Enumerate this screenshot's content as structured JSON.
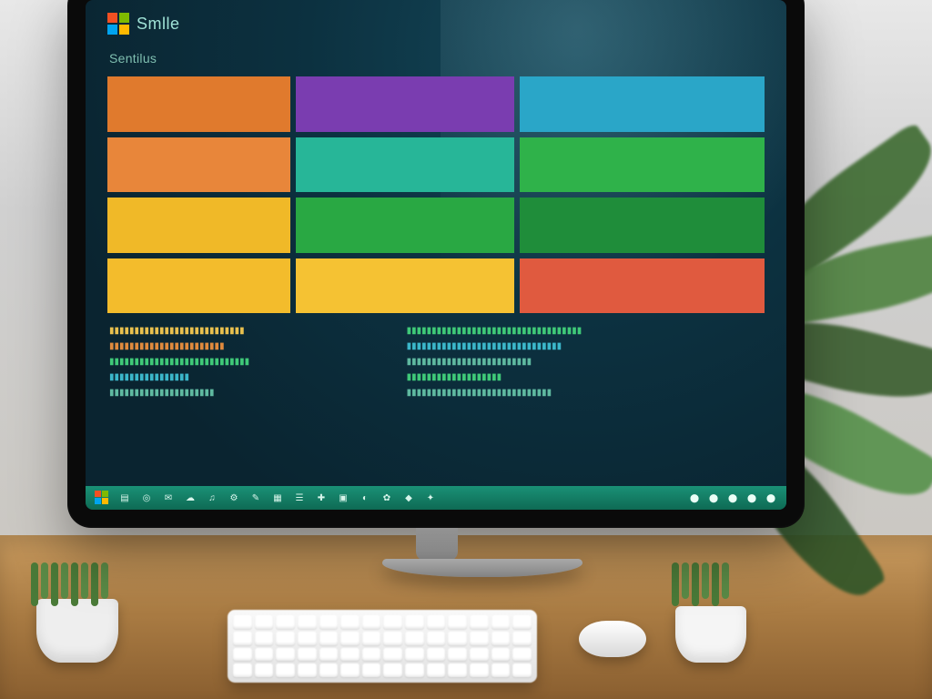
{
  "brand": "Smlle",
  "section_heading": "Sentilus",
  "tiles": [
    {
      "id": "t1",
      "color": "c-orange1",
      "title": "",
      "sub": ""
    },
    {
      "id": "t2",
      "color": "c-purple muted",
      "title": "",
      "sub": ""
    },
    {
      "id": "t3",
      "color": "c-cyan muted",
      "title": "",
      "sub": ""
    },
    {
      "id": "t4",
      "color": "c-orange2",
      "title": "",
      "sub": ""
    },
    {
      "id": "t5",
      "color": "c-teal muted",
      "title": "",
      "sub": ""
    },
    {
      "id": "t6",
      "color": "c-green1 muted",
      "title": "",
      "sub": ""
    },
    {
      "id": "t7",
      "color": "c-yellow1",
      "title": "",
      "sub": ""
    },
    {
      "id": "t8",
      "color": "c-green2 muted",
      "title": "",
      "sub": ""
    },
    {
      "id": "t9",
      "color": "c-green3 muted",
      "title": "",
      "sub": ""
    },
    {
      "id": "t10",
      "color": "c-yellow2",
      "title": "",
      "sub": ""
    },
    {
      "id": "t11",
      "color": "c-yellow3",
      "title": "",
      "sub": ""
    },
    {
      "id": "t12",
      "color": "c-red muted",
      "title": "",
      "sub": ""
    }
  ],
  "code_left": [
    {
      "cls": "hl-y",
      "txt": "▮▮▮▮▮▮▮▮▮▮▮▮▮▮▮▮▮▮▮▮▮▮▮▮▮▮▮"
    },
    {
      "cls": "hl-o",
      "txt": "▮▮▮▮▮▮▮▮▮▮▮▮▮▮▮▮▮▮▮▮▮▮▮"
    },
    {
      "cls": "hl-g",
      "txt": "▮▮▮▮▮▮▮▮▮▮▮▮▮▮▮▮▮▮▮▮▮▮▮▮▮▮▮▮"
    },
    {
      "cls": "hl-c",
      "txt": "▮▮▮▮▮▮▮▮▮▮▮▮▮▮▮▮"
    },
    {
      "cls": "",
      "txt": "▮▮▮▮▮▮▮▮▮▮▮▮▮▮▮▮▮▮▮▮▮"
    }
  ],
  "code_right": [
    {
      "cls": "hl-g",
      "txt": "▮▮▮▮▮▮▮▮▮▮▮▮▮▮▮▮▮▮▮▮▮▮▮▮▮▮▮▮▮▮▮▮▮▮▮"
    },
    {
      "cls": "hl-c",
      "txt": "▮▮▮▮▮▮▮▮▮▮▮▮▮▮▮▮▮▮▮▮▮▮▮▮▮▮▮▮▮▮▮"
    },
    {
      "cls": "",
      "txt": "▮▮▮▮▮▮▮▮▮▮▮▮▮▮▮▮▮▮▮▮▮▮▮▮▮"
    },
    {
      "cls": "hl-g",
      "txt": "▮▮▮▮▮▮▮▮▮▮▮▮▮▮▮▮▮▮▮"
    },
    {
      "cls": "",
      "txt": "▮▮▮▮▮▮▮▮▮▮▮▮▮▮▮▮▮▮▮▮▮▮▮▮▮▮▮▮▮"
    }
  ],
  "taskbar_icons": [
    "▤",
    "◎",
    "✉",
    "☁",
    "♫",
    "⚙",
    "✎",
    "▦",
    "☰",
    "✚",
    "▣",
    "◐",
    "✿",
    "◆",
    "✦"
  ],
  "tray_icons": [
    "⬤",
    "⬤",
    "⬤",
    "⬤",
    "⬤"
  ]
}
